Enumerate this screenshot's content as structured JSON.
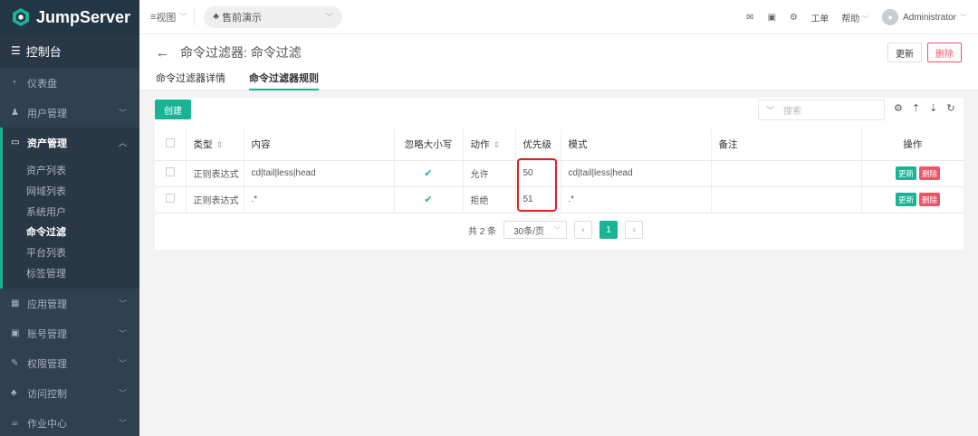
{
  "brand": {
    "name": "JumpServer"
  },
  "sidebar": {
    "console": "控制台",
    "items": [
      {
        "label": "仪表盘",
        "icon": "dashboard-icon"
      },
      {
        "label": "用户管理",
        "icon": "users-icon"
      },
      {
        "label": "资产管理",
        "icon": "inbox-icon"
      },
      {
        "label": "应用管理",
        "icon": "grid-icon"
      },
      {
        "label": "账号管理",
        "icon": "id-card-icon"
      },
      {
        "label": "权限管理",
        "icon": "edit-icon"
      },
      {
        "label": "访问控制",
        "icon": "sitemap-icon"
      },
      {
        "label": "作业中心",
        "icon": "coffee-icon"
      }
    ],
    "sub_items": [
      "资产列表",
      "网域列表",
      "系统用户",
      "命令过滤",
      "平台列表",
      "标签管理"
    ]
  },
  "topbar": {
    "view_label": "视图",
    "org": "售前演示",
    "ticket": "工单",
    "help": "帮助",
    "user": "Administrator"
  },
  "page": {
    "title": "命令过滤器: 命令过滤",
    "update": "更新",
    "delete": "删除",
    "tabs": [
      "命令过滤器详情",
      "命令过滤器规则"
    ]
  },
  "toolbar": {
    "create": "创建",
    "search_placeholder": "搜索"
  },
  "table": {
    "headers": [
      "类型",
      "内容",
      "忽略大小写",
      "动作",
      "优先级",
      "模式",
      "备注",
      "操作"
    ],
    "rows": [
      {
        "type": "正则表达式",
        "content": "cd|tail|less|head",
        "action": "允许",
        "priority": "50",
        "pattern": "cd|tail|less|head",
        "comment": ""
      },
      {
        "type": "正则表达式",
        "content": ".*",
        "action": "拒绝",
        "priority": "51",
        "pattern": ".*",
        "comment": ""
      }
    ],
    "row_update": "更新",
    "row_delete": "删除"
  },
  "pagination": {
    "total": "共 2 条",
    "page_size": "30条/页",
    "current": "1"
  },
  "colors": {
    "accent": "#1ab394",
    "danger": "#ed5565",
    "sidebar": "#2f4050",
    "highlight": "#e02020"
  }
}
